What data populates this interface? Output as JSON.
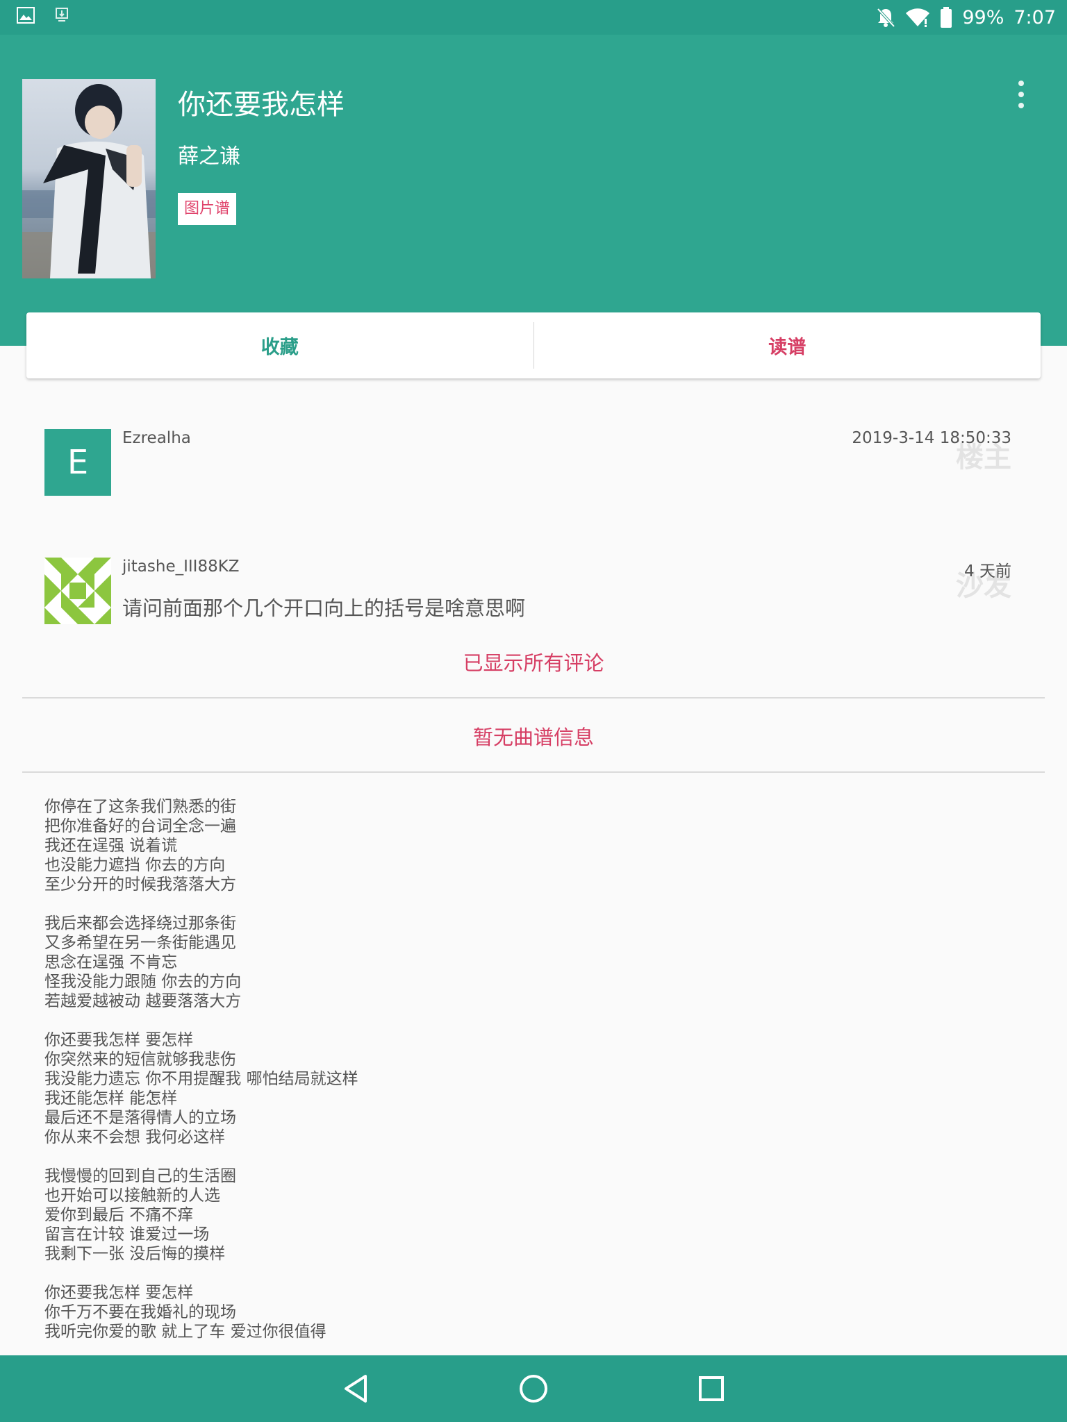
{
  "status_bar": {
    "battery": "99%",
    "time": "7:07",
    "left_icons": [
      "image-icon",
      "download-icon"
    ],
    "right_icons": [
      "notifications-off-icon",
      "wifi-icon",
      "battery-icon"
    ]
  },
  "song": {
    "title": "你还要我怎样",
    "artist": "薛之谦",
    "tag": "图片谱"
  },
  "actions": {
    "favorite": "收藏",
    "read_score": "读谱"
  },
  "comments": [
    {
      "avatar_letter": "E",
      "user": "Ezrealha",
      "time": "2019-3-14 18:50:33",
      "floor": "楼主",
      "text": ""
    },
    {
      "user": "jitashe_III88KZ",
      "time": "4 天前",
      "floor": "沙发",
      "text": "请问前面那个几个开口向上的括号是啥意思啊"
    }
  ],
  "all_comments_shown": "已显示所有评论",
  "no_score_info": "暂无曲谱信息",
  "lyrics": [
    [
      "你停在了这条我们熟悉的街",
      "把你准备好的台词全念一遍",
      "我还在逞强 说着谎",
      "也没能力遮挡 你去的方向",
      "至少分开的时候我落落大方"
    ],
    [
      "我后来都会选择绕过那条街",
      "又多希望在另一条街能遇见",
      "思念在逞强 不肯忘",
      "怪我没能力跟随 你去的方向",
      "若越爱越被动 越要落落大方"
    ],
    [
      "你还要我怎样 要怎样",
      "你突然来的短信就够我悲伤",
      "我没能力遗忘 你不用提醒我 哪怕结局就这样",
      "我还能怎样 能怎样",
      "最后还不是落得情人的立场",
      "你从来不会想 我何必这样"
    ],
    [
      "我慢慢的回到自己的生活圈",
      "也开始可以接触新的人选",
      "爱你到最后 不痛不痒",
      "留言在计较 谁爱过一场",
      "我剩下一张 没后悔的摸样"
    ],
    [
      "你还要我怎样 要怎样",
      "你千万不要在我婚礼的现场",
      "我听完你爱的歌 就上了车 爱过你很值得"
    ]
  ],
  "colors": {
    "primary": "#2fa690",
    "status_bar": "#289e8a",
    "accent": "#d63e64"
  }
}
